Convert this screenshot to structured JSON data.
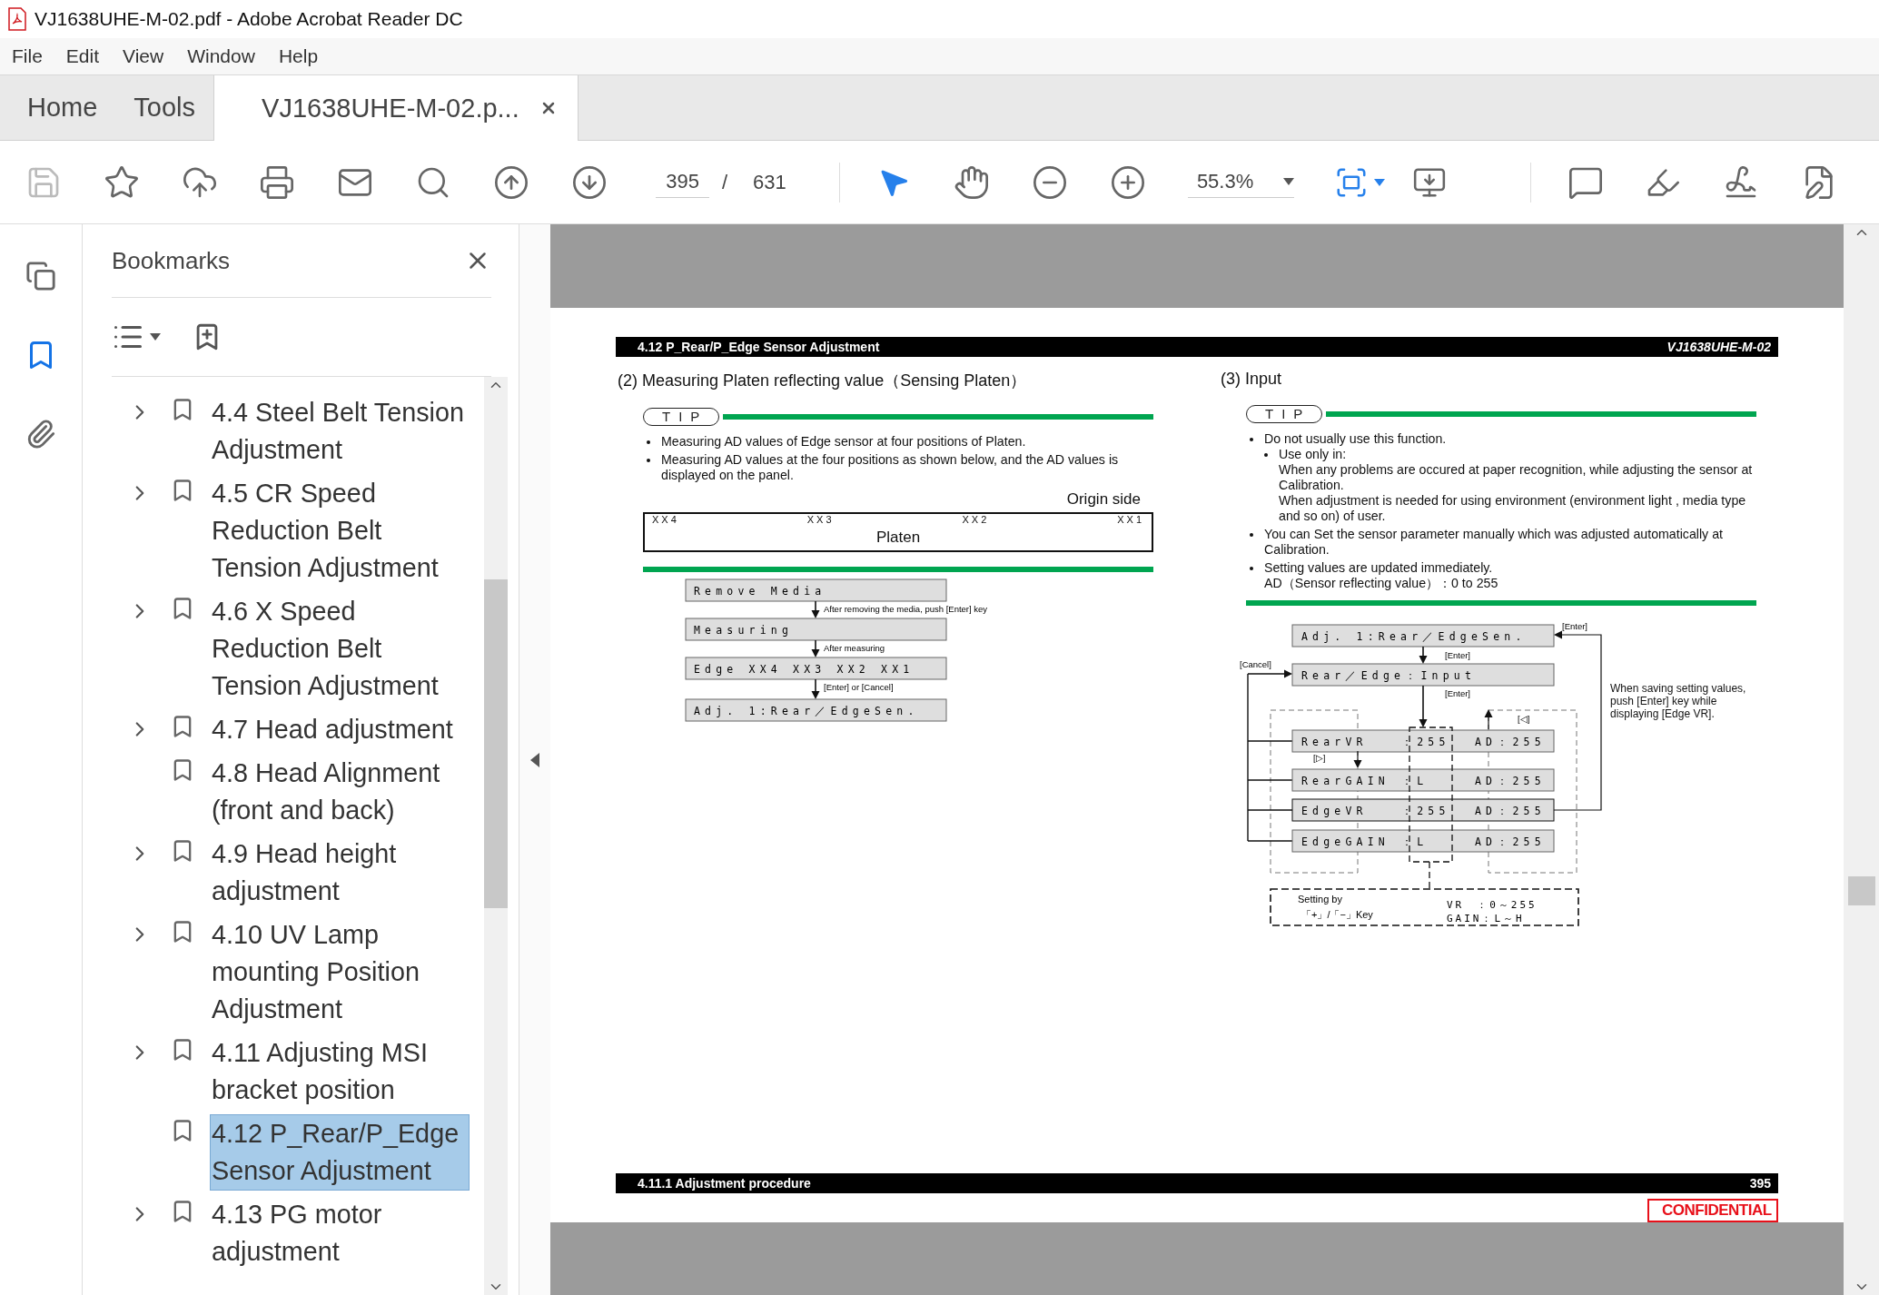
{
  "window": {
    "title": "VJ1638UHE-M-02.pdf - Adobe Acrobat Reader DC"
  },
  "menu": [
    "File",
    "Edit",
    "View",
    "Window",
    "Help"
  ],
  "tabs": [
    {
      "label": "Home",
      "selected": false
    },
    {
      "label": "Tools",
      "selected": false
    },
    {
      "label": "VJ1638UHE-M-02.p...",
      "selected": true
    }
  ],
  "toolbar": {
    "page_current": "395",
    "page_separator": "/",
    "page_total": "631",
    "zoom": "55.3%"
  },
  "rail": [
    {
      "kind": "pages",
      "selected": false
    },
    {
      "kind": "bookmarks",
      "selected": true
    },
    {
      "kind": "attachments",
      "selected": false
    }
  ],
  "sidebar": {
    "title": "Bookmarks",
    "items": [
      {
        "label": "4.4 Steel Belt Tension Adjustment",
        "expandable": true,
        "selected": false
      },
      {
        "label": "4.5 CR Speed Reduction Belt Tension Adjustment",
        "expandable": true,
        "selected": false
      },
      {
        "label": "4.6 X Speed Reduction Belt Tension Adjustment",
        "expandable": true,
        "selected": false
      },
      {
        "label": "4.7 Head adjustment",
        "expandable": true,
        "selected": false
      },
      {
        "label": "4.8 Head Alignment (front and back)",
        "expandable": false,
        "selected": false
      },
      {
        "label": "4.9 Head height adjustment",
        "expandable": true,
        "selected": false
      },
      {
        "label": "4.10 UV Lamp mounting Position Adjustment",
        "expandable": true,
        "selected": false
      },
      {
        "label": "4.11 Adjusting MSI bracket position",
        "expandable": true,
        "selected": false
      },
      {
        "label": "4.12 P_Rear/P_Edge Sensor Adjustment",
        "expandable": false,
        "selected": true
      },
      {
        "label": "4.13 PG motor adjustment",
        "expandable": true,
        "selected": false
      }
    ]
  },
  "document": {
    "header_title": "4.12 P_Rear/P_Edge Sensor Adjustment",
    "header_code": "VJ1638UHE-M-02",
    "left": {
      "heading": "(2) Measuring Platen reflecting value（Sensing Platen）",
      "tip": "TIP",
      "bullets": [
        "Measuring AD values of Edge sensor at four positions of Platen.",
        "Measuring AD values at the four positions as shown below, and the AD values is displayed on the panel."
      ],
      "origin": "Origin side",
      "platen": {
        "label": "Platen",
        "positions": [
          "XX4",
          "XX3",
          "XX2",
          "XX1"
        ]
      },
      "flow": [
        {
          "display": "Remove Media",
          "note": "After removing the media, push [Enter] key"
        },
        {
          "display": "Measuring",
          "note": "After measuring"
        },
        {
          "display": "Edge XX4 XX3 XX2 XX1",
          "note": "[Enter] or [Cancel]"
        },
        {
          "display": "Adj. 1:Rear／EdgeSen."
        }
      ]
    },
    "right": {
      "heading": "(3) Input",
      "tip": "TIP",
      "bullets": [
        {
          "text": "Do not usually use this function.",
          "children": [
            {
              "text": "Use only in:",
              "lines": [
                "When any problems are occured at paper recognition, while adjusting the sensor at Calibration.",
                "When adjustment is needed for using environment (environment light , media type and so on) of user."
              ]
            }
          ]
        },
        {
          "text": "You can Set the sensor parameter manually which was adjusted automatically at Calibration."
        },
        {
          "text": "Setting values are updated immediately.",
          "lines": [
            "AD（Sensor reflecting value）：0 to 255"
          ]
        }
      ],
      "diagram": {
        "top": "Adj. 1:Rear／EdgeSen.",
        "input": "Rear／Edge：Input",
        "rows": [
          {
            "name": "RearVR",
            "value": "：255",
            "ad": "AD：255"
          },
          {
            "name": "RearGAIN",
            "value": "：L",
            "ad": "AD：255"
          },
          {
            "name": "EdgeVR",
            "value": "：255",
            "ad": "AD：255"
          },
          {
            "name": "EdgeGAIN",
            "value": "：L",
            "ad": "AD：255"
          }
        ],
        "labels": {
          "enter_loop": "[Enter]",
          "enter_1": "[Enter]",
          "cancel": "[Cancel]",
          "enter_2": "[Enter]",
          "next": "[▷]",
          "prev": "[◁]"
        },
        "note": "When saving setting values, push [Enter] key while displaying [Edge VR].",
        "setting": {
          "title": "Setting by",
          "keys": "「+」/「−」Key",
          "vr": "VR　：0～255",
          "gain": "GAIN：L～H"
        }
      }
    },
    "footer_title": "4.11.1 Adjustment procedure",
    "page_number": "395",
    "stamp": "CONFIDENTIAL"
  }
}
